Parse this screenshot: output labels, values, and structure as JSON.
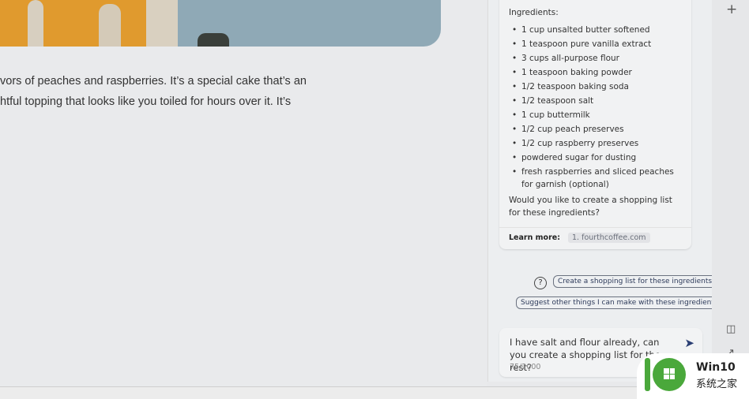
{
  "article": {
    "lines": [
      "vors of peaches and raspberries. It’s a special cake that’s an",
      "htful topping that looks like you toiled for hours over it. It’s"
    ]
  },
  "chat": {
    "heading": "Ingredients:",
    "ingredients": [
      "1 cup unsalted butter softened",
      "1 teaspoon pure vanilla extract",
      "3 cups all-purpose flour",
      "1 teaspoon baking powder",
      "1/2 teaspoon baking soda",
      "1/2 teaspoon salt",
      "1 cup buttermilk",
      "1/2 cup peach preserves",
      "1/2 cup raspberry preserves",
      "powdered sugar for dusting",
      "fresh raspberries and sliced peaches for garnish (optional)"
    ],
    "question": "Would you like to create a shopping list for these ingredients?",
    "learn_more_label": "Learn more:",
    "learn_more_link": "1. fourthcoffee.com",
    "suggestions": [
      "Create a shopping list for these ingredients.",
      "Suggest other things I can make with these ingredients."
    ],
    "input_text": "I have salt and flour already, can you create a shopping list for the rest?",
    "char_count": "75/2000"
  },
  "watermark": {
    "line1": "Win10",
    "line2": "系统之家"
  }
}
